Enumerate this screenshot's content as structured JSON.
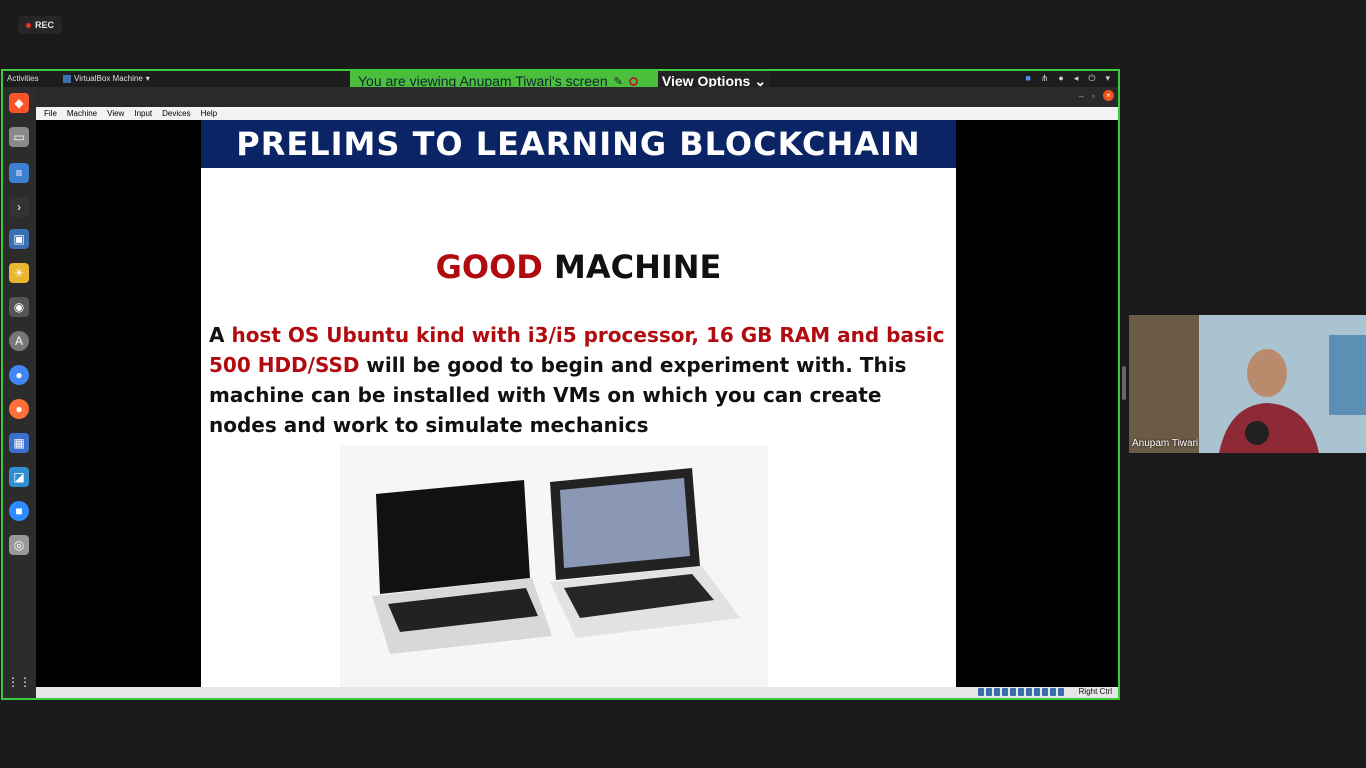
{
  "recording": {
    "label": "REC"
  },
  "share": {
    "banner": "You are viewing Anupam Tiwari's screen",
    "view_options": "View Options"
  },
  "ubuntu": {
    "activities": "Activities",
    "app_menu": "VirtualBox Machine"
  },
  "vbox": {
    "menu": [
      "File",
      "Machine",
      "View",
      "Input",
      "Devices",
      "Help"
    ],
    "status_host_key": "Right Ctrl"
  },
  "slide": {
    "header": "PRELIMS TO LEARNING BLOCKCHAIN",
    "title_word_1": "GOOD",
    "title_word_2": "MACHINE",
    "body_prefix": "A ",
    "body_highlight": "host OS Ubuntu kind with i3/i5 processor, 16 GB RAM and basic 500 HDD/SSD",
    "body_suffix": " will be good to begin and experiment with. This machine can be installed with VMs on which you can create nodes and work to simulate mechanics"
  },
  "participant": {
    "name": "Anupam Tiwari"
  },
  "icons": [
    "brave-icon",
    "files-icon",
    "text-editor-icon",
    "terminal-icon",
    "virtualbox-icon",
    "weather-icon",
    "screenshot-icon",
    "software-center-icon",
    "chrome-icon",
    "firefox-icon",
    "screen-icon",
    "vm-icon",
    "zoom-icon",
    "disk-icon",
    "app-grid-icon"
  ],
  "colors": {
    "share_border": "#3dcb3d",
    "slide_header": "#0a2465",
    "highlight": "#b00c10"
  }
}
